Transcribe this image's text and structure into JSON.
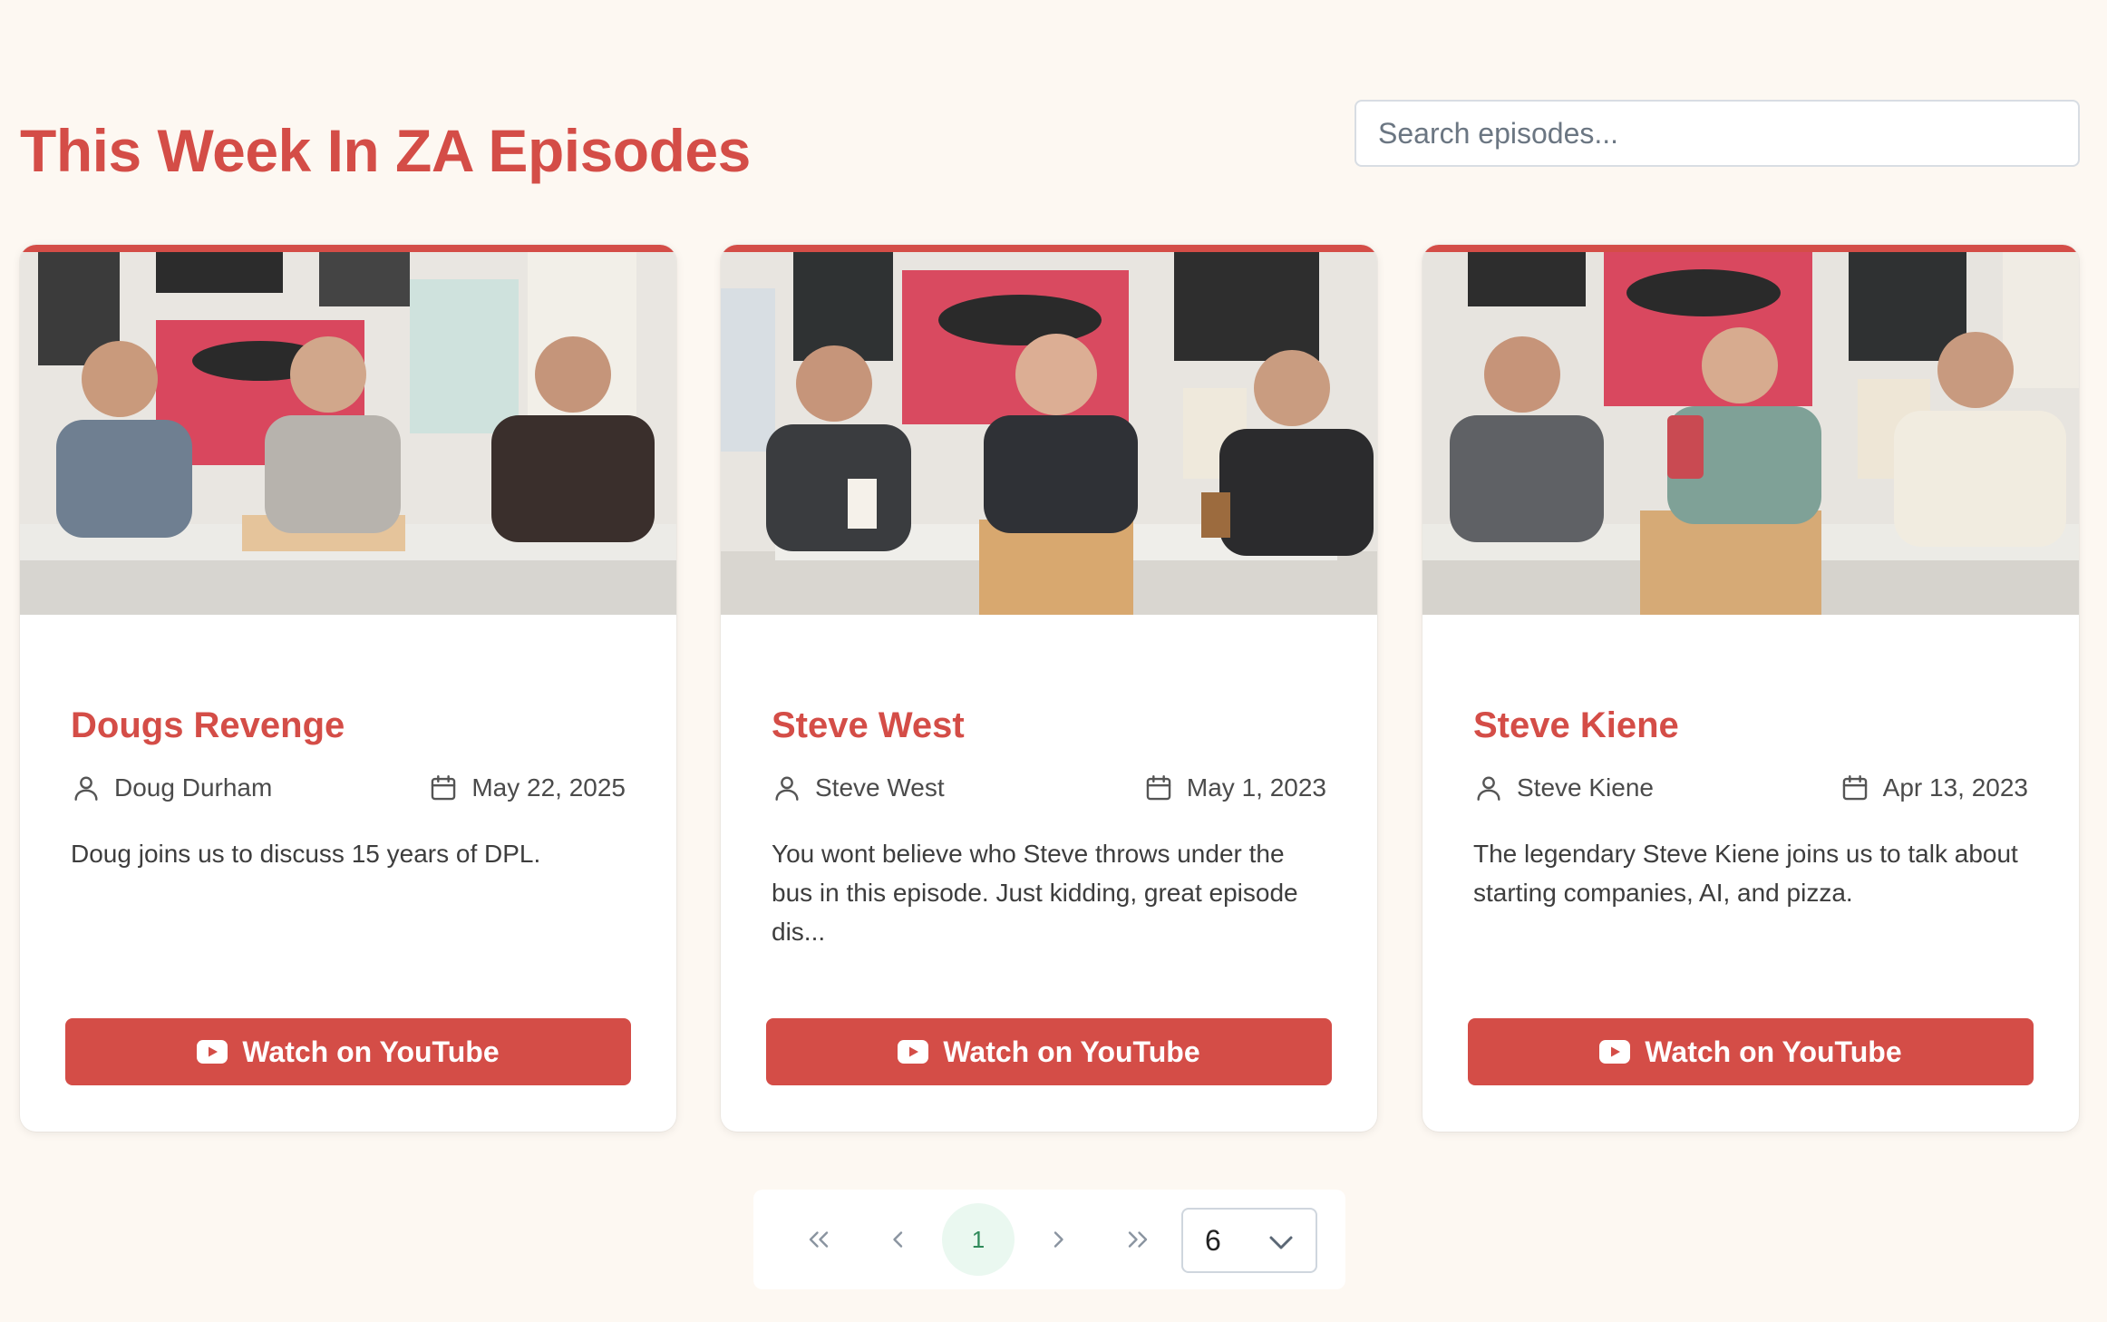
{
  "page": {
    "title": "This Week In ZA Episodes",
    "search_placeholder": "Search episodes..."
  },
  "episodes": [
    {
      "title": "Dougs Revenge",
      "guest": "Doug Durham",
      "date": "May 22, 2025",
      "description": "Doug joins us to discuss 15 years of DPL.",
      "button_label": "Watch on YouTube"
    },
    {
      "title": "Steve West",
      "guest": "Steve West",
      "date": "May 1, 2023",
      "description": "You wont believe who Steve throws under the bus in this episode. Just kidding, great episode dis...",
      "button_label": "Watch on YouTube"
    },
    {
      "title": "Steve Kiene",
      "guest": "Steve Kiene",
      "date": "Apr 13, 2023",
      "description": "The legendary Steve Kiene joins us to talk about starting companies, AI, and pizza.",
      "button_label": "Watch on YouTube"
    }
  ],
  "pagination": {
    "current_page": "1",
    "page_size": "6"
  },
  "icons": {
    "user": "user-icon",
    "calendar": "calendar-icon",
    "youtube": "youtube-icon",
    "first": "chevrons-left-icon",
    "prev": "chevron-left-icon",
    "next": "chevron-right-icon",
    "last": "chevrons-right-icon",
    "dropdown": "chevron-down-icon"
  },
  "colors": {
    "accent": "#d44d47",
    "background": "#fdf8f2",
    "current_page_bg": "#eaf8f0",
    "current_page_text": "#2f8a5a"
  }
}
